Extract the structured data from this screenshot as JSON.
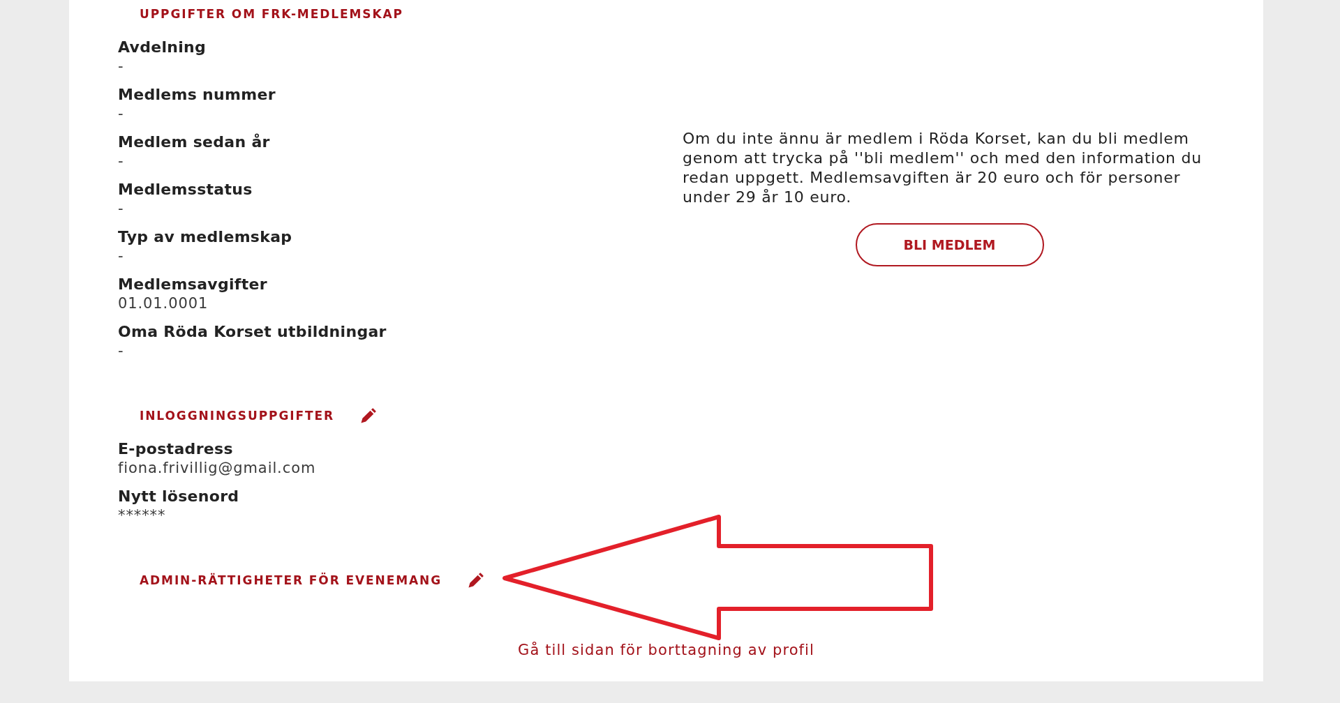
{
  "sections": [
    {
      "heading": "UPPGIFTER OM FRK-MEDLEMSKAP",
      "editable": false,
      "fields": [
        {
          "label": "Avdelning",
          "value": "-"
        },
        {
          "label": "Medlems nummer",
          "value": "-"
        },
        {
          "label": "Medlem sedan år",
          "value": "-"
        },
        {
          "label": "Medlemsstatus",
          "value": "-"
        },
        {
          "label": "Typ av medlemskap",
          "value": "-"
        },
        {
          "label": "Medlemsavgifter",
          "value": "01.01.0001"
        },
        {
          "label": "Oma Röda Korset utbildningar",
          "value": "-"
        }
      ]
    },
    {
      "heading": "INLOGGNINGSUPPGIFTER",
      "editable": true,
      "fields": [
        {
          "label": "E-postadress",
          "value": "fiona.frivillig@gmail.com"
        },
        {
          "label": "Nytt lösenord",
          "value": "******"
        }
      ]
    },
    {
      "heading": "ADMIN-RÄTTIGHETER FÖR EVENEMANG",
      "editable": true
    }
  ],
  "join_panel": {
    "text": "Om du inte ännu är medlem i Röda Korset, kan du bli medlem genom att trycka på ''bli medlem'' och med den information du redan uppgett. Medlemsavgiften är 20 euro och för personer under 29 år 10 euro.",
    "button": "BLI MEDLEM"
  },
  "delete_profile_link": "Gå till sidan för borttagning av profil",
  "annotations": [
    {
      "kind": "arrow"
    }
  ]
}
